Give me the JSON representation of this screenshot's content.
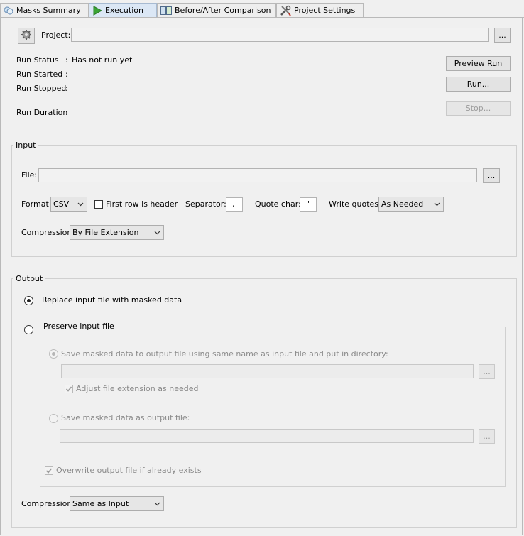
{
  "tabs": [
    {
      "label": "Masks Summary",
      "icon": "masks-icon"
    },
    {
      "label": "Execution",
      "icon": "play-icon"
    },
    {
      "label": "Before/After Comparison",
      "icon": "compare-icon"
    },
    {
      "label": "Project Settings",
      "icon": "tools-icon"
    }
  ],
  "project": {
    "label": "Project:",
    "value": "",
    "browse_label": "..."
  },
  "run": {
    "status_label": "Run Status",
    "status_sep": ":",
    "status_value": "Has not run yet",
    "started_label": "Run Started",
    "started_sep": ":",
    "stopped_label": "Run Stopped",
    "stopped_sep": ":",
    "duration_label": "Run Duration",
    "duration_sep": ":",
    "preview_button": "Preview Run",
    "run_button": "Run...",
    "stop_button": "Stop..."
  },
  "input": {
    "title": "Input",
    "file_label": "File:",
    "file_value": "",
    "browse_label": "...",
    "format_label": "Format:",
    "format_value": "CSV",
    "first_row_label": "First row is header",
    "first_row_checked": false,
    "separator_label": "Separator:",
    "separator_value": ",",
    "quote_label": "Quote char:",
    "quote_value": "\"",
    "write_quotes_label": "Write quotes:",
    "write_quotes_value": "As Needed",
    "compression_label": "Compression:",
    "compression_value": "By File Extension"
  },
  "output": {
    "title": "Output",
    "replace_label": "Replace input file with masked data",
    "preserve_label": "Preserve input file",
    "save_dir_label": "Save masked data to output file using same name as input file and put in directory:",
    "dir_value": "",
    "dir_browse": "...",
    "adjust_ext_label": "Adjust file extension as needed",
    "save_file_label": "Save masked data as output file:",
    "file_value": "",
    "file_browse": "...",
    "overwrite_label": "Overwrite output file if already exists",
    "compression_label": "Compression:",
    "compression_value": "Same as Input",
    "selected": "replace"
  },
  "colors": {
    "tab_active_bg": "#dbe7f5",
    "play_green": "#3aa435"
  }
}
